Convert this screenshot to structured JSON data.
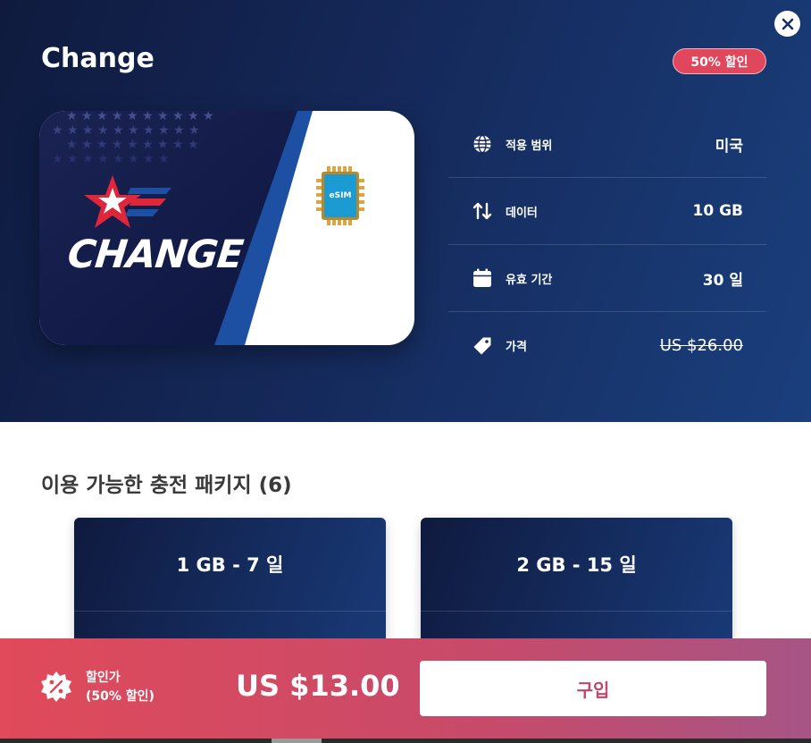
{
  "header": {
    "title": "Change",
    "discount_badge": "50% 할인",
    "close_icon": "close-icon"
  },
  "card": {
    "brand": "CHANGE",
    "chip_label": "eSIM"
  },
  "details": [
    {
      "icon": "globe-icon",
      "label": "적용 범위",
      "value": "미국"
    },
    {
      "icon": "data-arrows-icon",
      "label": "데이터",
      "value": "10 GB"
    },
    {
      "icon": "calendar-icon",
      "label": "유효 기간",
      "value": "30 일"
    },
    {
      "icon": "price-tag-icon",
      "label": "가격",
      "value": "US $26.00"
    }
  ],
  "packages": {
    "title": "이용 가능한 충전 패키지 (6)",
    "items": [
      {
        "label": "1 GB - 7 일"
      },
      {
        "label": "2 GB - 15 일"
      }
    ]
  },
  "footer": {
    "label_line1": "할인가",
    "label_line2": "(50% 할인)",
    "price": "US $13.00",
    "buy_label": "구입",
    "icon": "discount-percent-icon"
  },
  "colors": {
    "header_dark": "#0f1a3e",
    "header_light": "#1a3f7d",
    "accent_red": "#e04a5a",
    "accent_pink": "#a65585",
    "buy_text": "#c0466a"
  }
}
